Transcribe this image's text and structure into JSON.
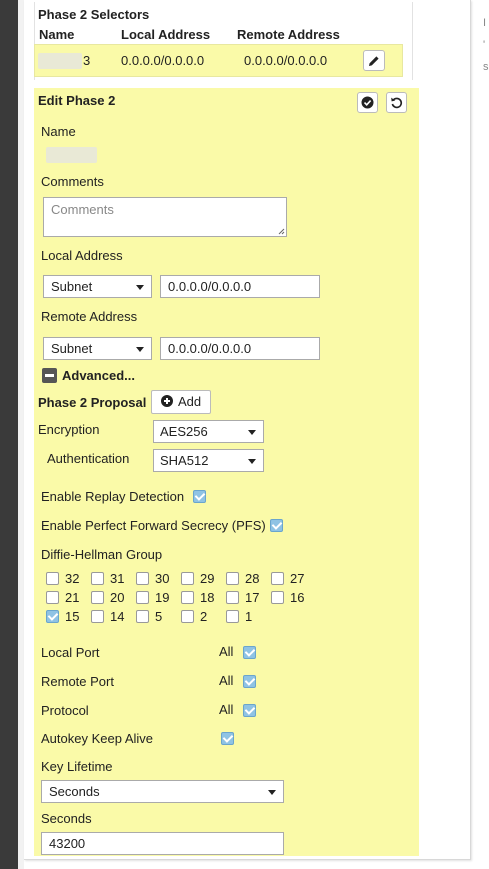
{
  "selectors": {
    "title": "Phase 2 Selectors",
    "columns": [
      "Name",
      "Local Address",
      "Remote Address"
    ],
    "row": {
      "name_suffix": "3",
      "local": "0.0.0.0/0.0.0.0",
      "remote": "0.0.0.0/0.0.0.0"
    }
  },
  "edit": {
    "title": "Edit Phase 2",
    "name_label": "Name",
    "comments_label": "Comments",
    "comments_placeholder": "Comments",
    "local_address_label": "Local Address",
    "local_type": "Subnet",
    "local_value": "0.0.0.0/0.0.0.0",
    "remote_address_label": "Remote Address",
    "remote_type": "Subnet",
    "remote_value": "0.0.0.0/0.0.0.0",
    "advanced_label": "Advanced...",
    "proposal_label": "Phase 2 Proposal",
    "add_label": "Add",
    "encryption_label": "Encryption",
    "encryption_value": "AES256",
    "authentication_label": "Authentication",
    "authentication_value": "SHA512",
    "replay_label": "Enable Replay Detection",
    "replay_checked": true,
    "pfs_label": "Enable Perfect Forward Secrecy (PFS)",
    "pfs_checked": true,
    "dh_label": "Diffie-Hellman Group",
    "dh_groups": [
      {
        "value": "32",
        "checked": false
      },
      {
        "value": "31",
        "checked": false
      },
      {
        "value": "30",
        "checked": false
      },
      {
        "value": "29",
        "checked": false
      },
      {
        "value": "28",
        "checked": false
      },
      {
        "value": "27",
        "checked": false
      },
      {
        "value": "21",
        "checked": false
      },
      {
        "value": "20",
        "checked": false
      },
      {
        "value": "19",
        "checked": false
      },
      {
        "value": "18",
        "checked": false
      },
      {
        "value": "17",
        "checked": false
      },
      {
        "value": "16",
        "checked": false
      },
      {
        "value": "15",
        "checked": true
      },
      {
        "value": "14",
        "checked": false
      },
      {
        "value": "5",
        "checked": false
      },
      {
        "value": "2",
        "checked": false
      },
      {
        "value": "1",
        "checked": false
      }
    ],
    "local_port_label": "Local Port",
    "local_port_all": "All",
    "remote_port_label": "Remote Port",
    "remote_port_all": "All",
    "protocol_label": "Protocol",
    "protocol_all": "All",
    "autokey_label": "Autokey Keep Alive",
    "key_lifetime_label": "Key Lifetime",
    "key_lifetime_value": "Seconds",
    "seconds_label": "Seconds",
    "seconds_value": "43200"
  },
  "right_edge_chars": [
    "I",
    "'",
    "s"
  ],
  "colors": {
    "highlight": "#fafaa8",
    "checkbox": "#8fc3e4",
    "sidebar": "#3a3a3a"
  }
}
